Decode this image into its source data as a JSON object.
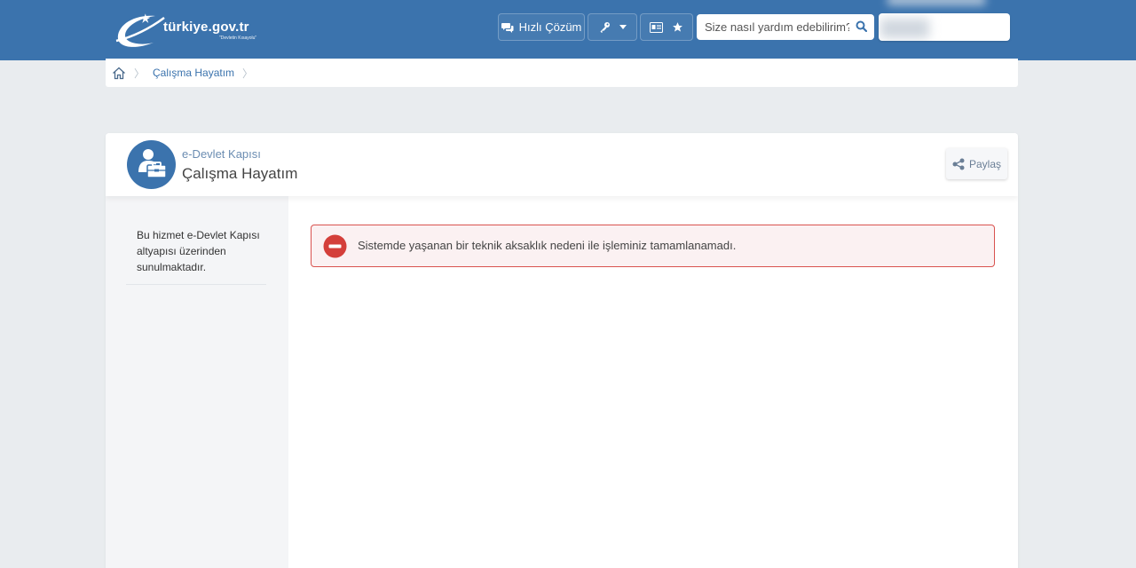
{
  "header": {
    "logo_text": "türkiye.gov.tr",
    "logo_subtext": "\"Devletin Kısayolu\"",
    "quick_solution_label": "Hızlı Çözüm",
    "search_placeholder": "Size nasıl yardım edebilirim?",
    "color": "#3b73ad"
  },
  "breadcrumb": {
    "items": [
      "Çalışma Hayatım"
    ]
  },
  "service": {
    "parent_label": "e-Devlet Kapısı",
    "title": "Çalışma Hayatım",
    "share_label": "Paylaş"
  },
  "sidebar": {
    "info_text": "Bu hizmet e-Devlet Kapısı altyapısı üzerinden sunulmaktadır."
  },
  "alert": {
    "message": "Sistemde yaşanan bir teknik aksaklık nedeni ile işleminiz tamamlanamadı.",
    "border_color": "#d9534f",
    "icon_color": "#d43f3a"
  }
}
